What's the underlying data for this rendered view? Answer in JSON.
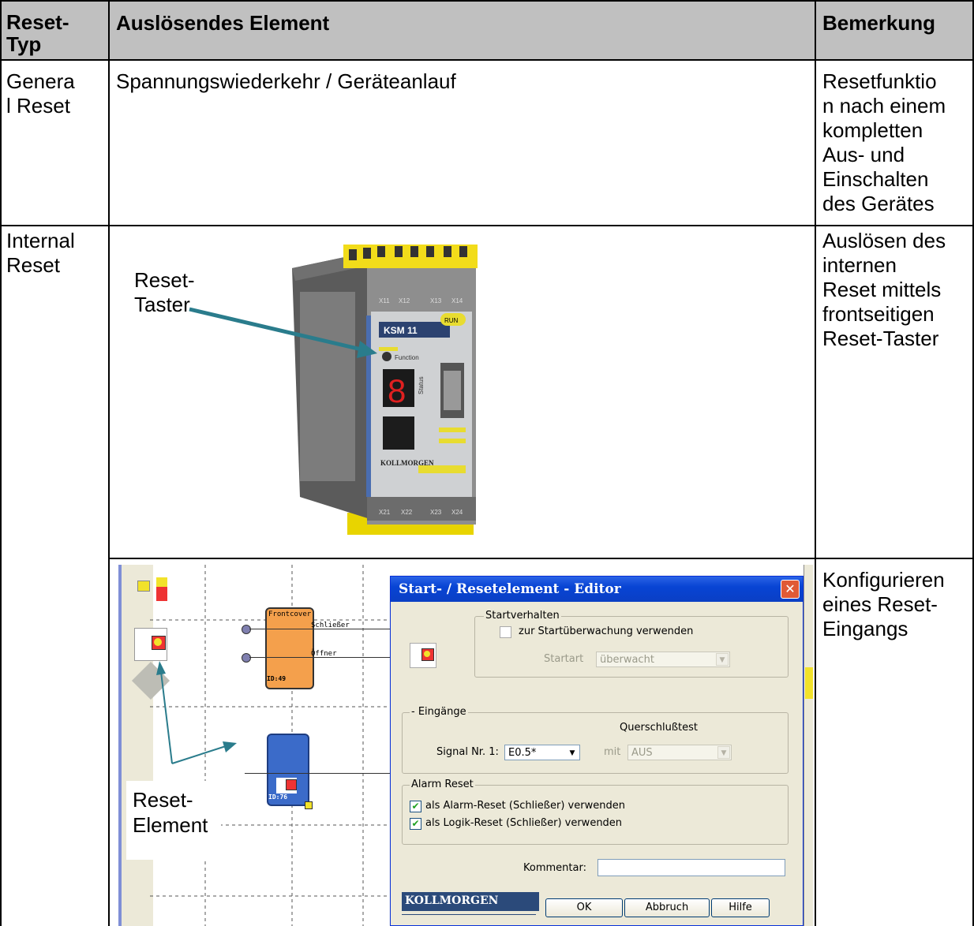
{
  "table": {
    "headers": [
      "Reset-\nTyp",
      "Auslösendes Element",
      "Bemerkung"
    ],
    "rows": [
      {
        "type": "Genera\nl Reset",
        "element": "Spannungswiederkehr / Geräteanlauf",
        "remark": "Resetfunktio\nn nach einem\nkompletten\nAus- und\nEinschalten\ndes Gerätes"
      },
      {
        "type": "Internal\nReset",
        "element_label": "Reset-\nTaster",
        "remark": "Auslösen des\ninternen\nReset mittels\nfrontseitigen\nReset-Taster"
      },
      {
        "element_label": "Reset-\nElement",
        "remark": "Konfigurieren\neines Reset-\nEingangs"
      }
    ]
  },
  "device": {
    "model": "KSM 11",
    "brand": "KOLLMORGEN",
    "run_label": "RUN",
    "function_label": "Function",
    "status_label": "Status",
    "display_digit": "8",
    "terminals_top": [
      "X11",
      "X12",
      "X13",
      "X14"
    ],
    "terminals_bottom": [
      "X21",
      "X22",
      "X23",
      "X24"
    ]
  },
  "diagram": {
    "block1_title": "Frontcover",
    "block1_contact1": "Schließer",
    "block1_contact2": "Öffner",
    "block1_id": "ID:49",
    "block2_id": "ID:76"
  },
  "dialog": {
    "title": "Start- / Resetelement - Editor",
    "close": "✕",
    "start_group": "Startverhalten",
    "start_checkbox": "zur Startüberwachung verwenden",
    "start_type_label": "Startart",
    "start_type_value": "überwacht",
    "inputs_group": "- Eingänge",
    "crosscheck_label": "Querschlußtest",
    "signal_label": "Signal Nr. 1:",
    "signal_value": "E0.5*",
    "with_label": "mit",
    "with_value": "AUS",
    "alarm_group": "Alarm Reset",
    "alarm_cb1": "als Alarm-Reset (Schließer) verwenden",
    "alarm_cb2": "als Logik-Reset (Schließer) verwenden",
    "comment_label": "Kommentar:",
    "brand": "KOLLMORGEN",
    "ok": "OK",
    "cancel": "Abbruch",
    "help": "Hilfe"
  }
}
